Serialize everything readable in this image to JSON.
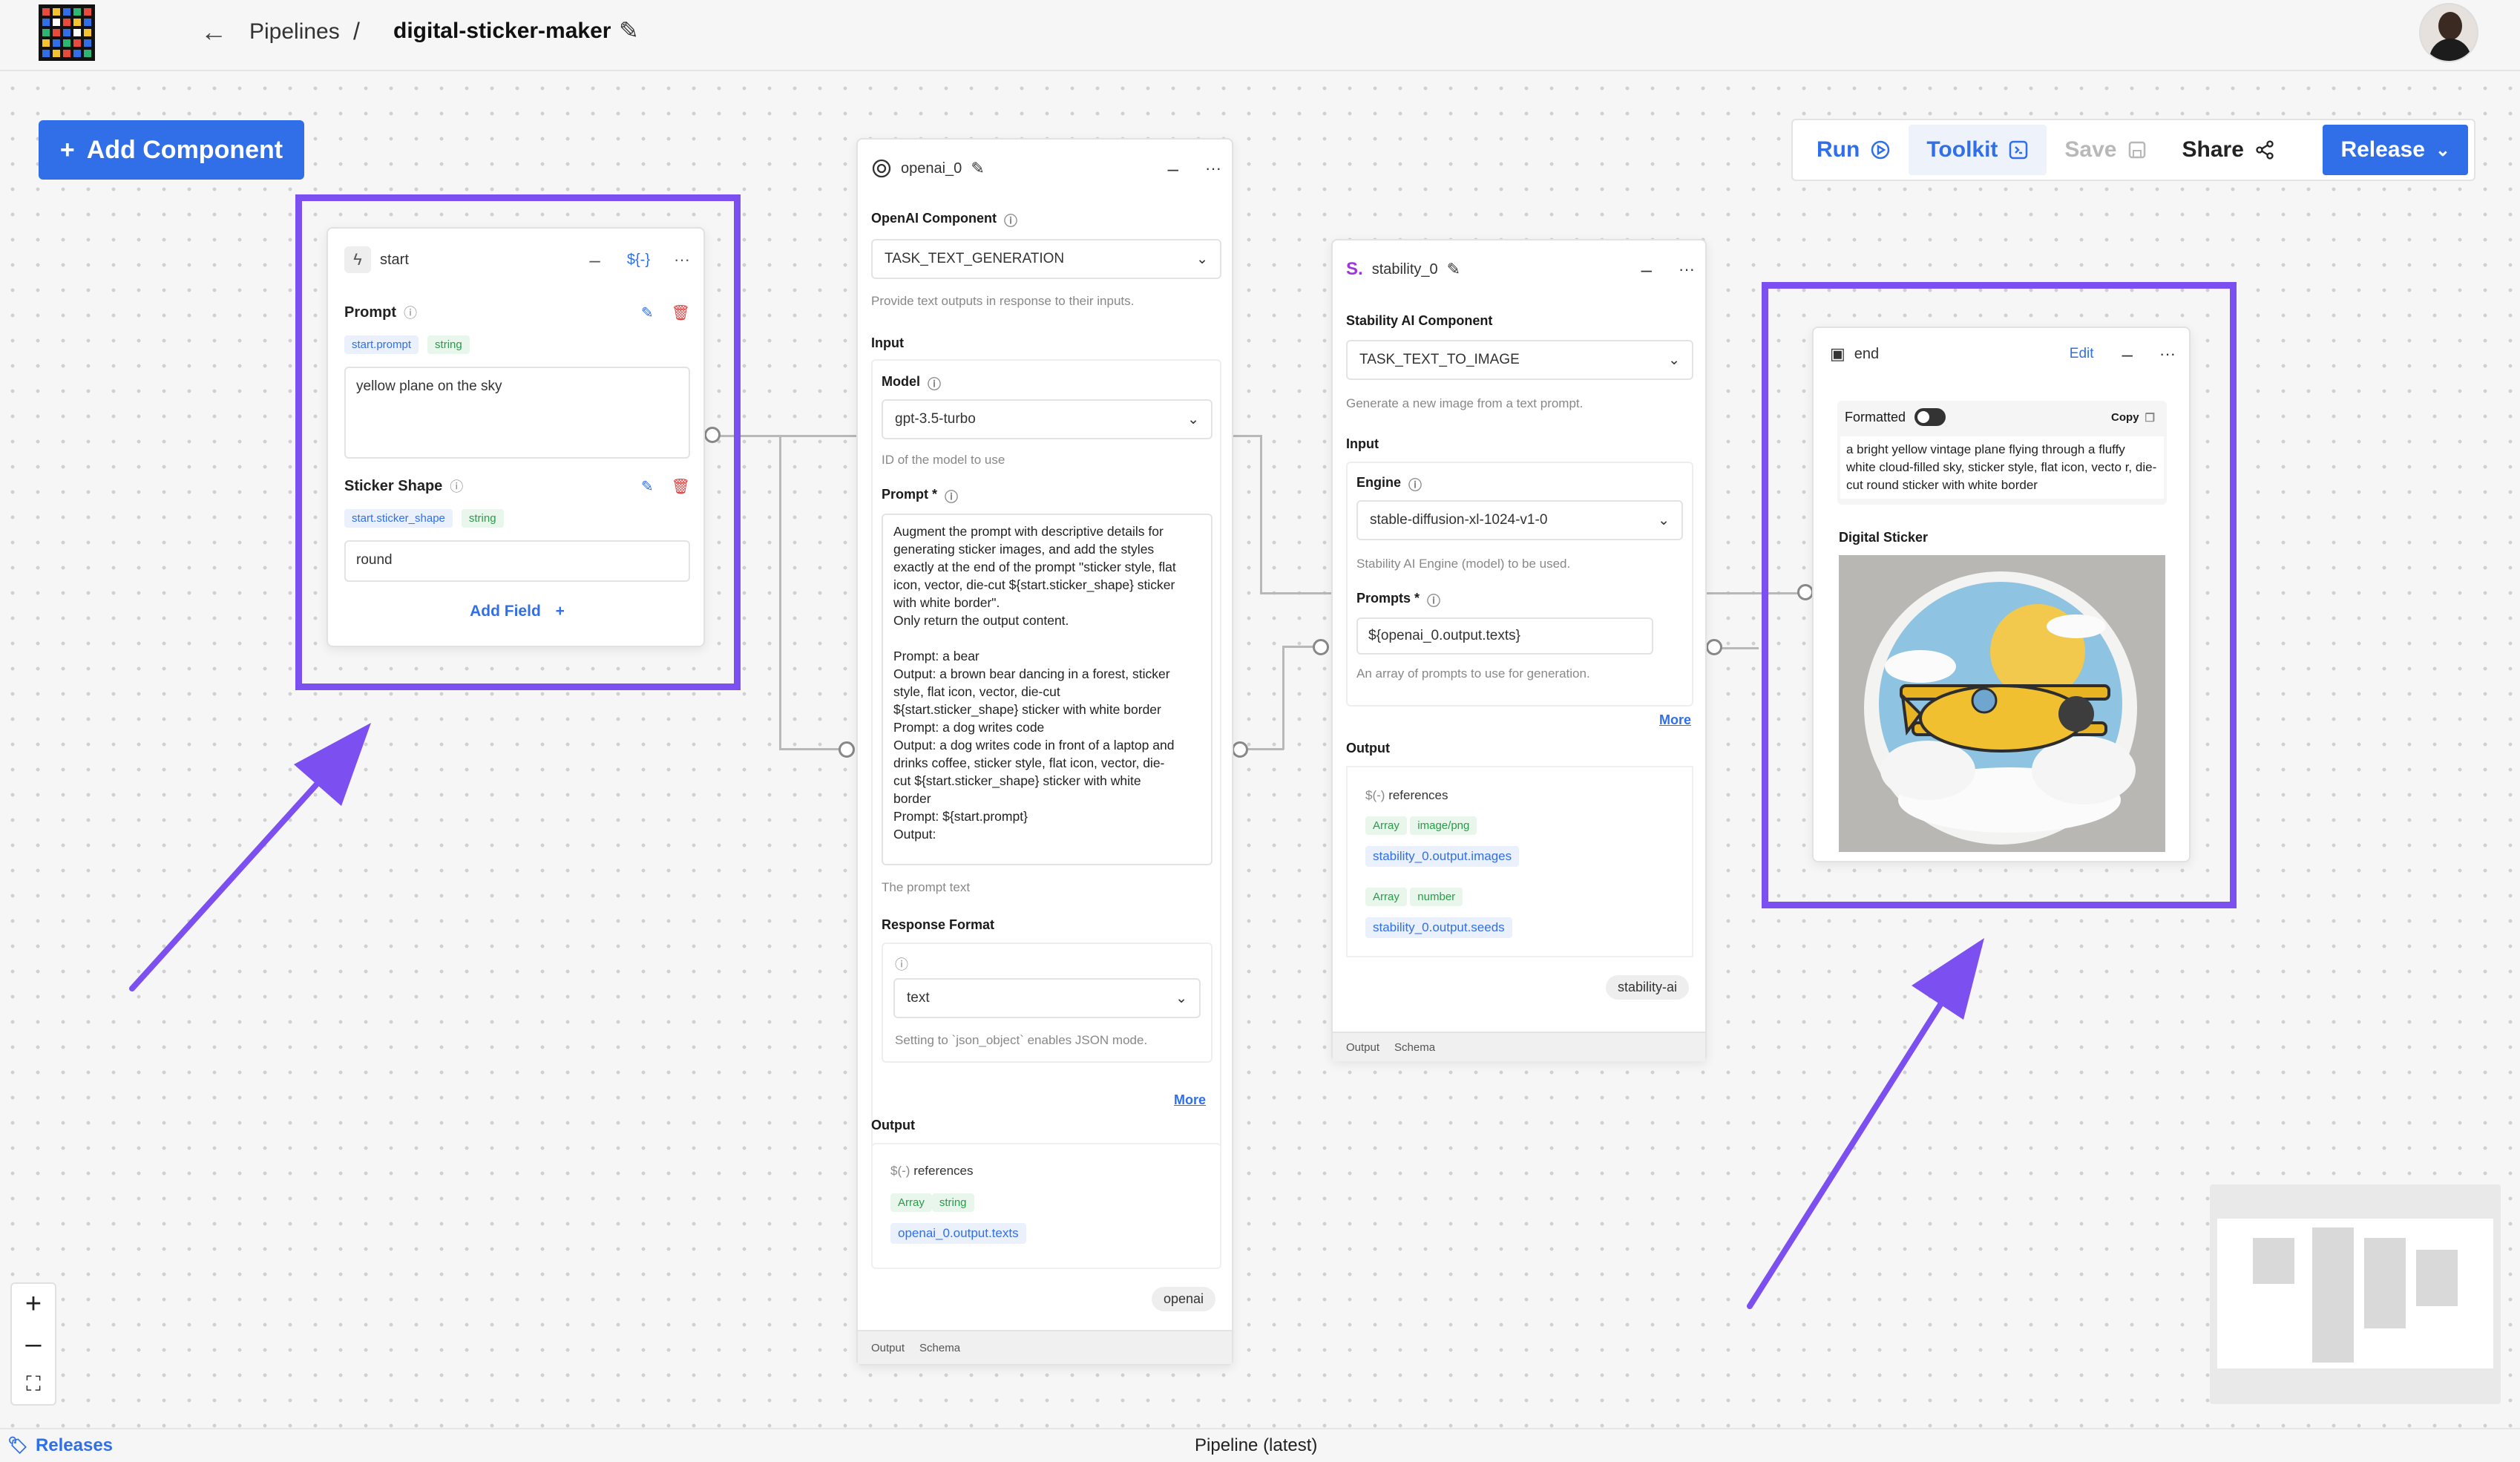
{
  "header": {
    "crumb_pipelines": "Pipelines",
    "crumb_sep": "/",
    "pipeline_name": "digital-sticker-maker"
  },
  "toolbar": {
    "add_component": "Add Component",
    "run": "Run",
    "toolkit": "Toolkit",
    "save": "Save",
    "share": "Share",
    "release": "Release"
  },
  "start_node": {
    "title": "start",
    "var_badge": "${-}",
    "fields": [
      {
        "label": "Prompt",
        "ref": "start.prompt",
        "type": "string",
        "value": "yellow plane on the sky"
      },
      {
        "label": "Sticker Shape",
        "ref": "start.sticker_shape",
        "type": "string",
        "value": "round"
      }
    ],
    "add_field": "Add Field"
  },
  "openai_node": {
    "title": "openai_0",
    "component_label": "OpenAI Component",
    "task": "TASK_TEXT_GENERATION",
    "task_desc": "Provide text outputs in response to their inputs.",
    "input_label": "Input",
    "model_label": "Model",
    "model_value": "gpt-3.5-turbo",
    "model_desc": "ID of the model to use",
    "prompt_label": "Prompt *",
    "prompt_value": "Augment the prompt with descriptive details for\ngenerating sticker images, and add the styles\nexactly at the end of the prompt \"sticker style, flat\nicon, vector, die-cut ${start.sticker_shape} sticker\nwith white border\".\nOnly return the output content.\n\nPrompt: a bear\nOutput: a brown bear dancing in a forest, sticker\nstyle, flat icon, vector, die-cut\n${start.sticker_shape} sticker with white border\nPrompt: a dog writes code\nOutput: a dog writes code in front of a laptop and\ndrinks coffee, sticker style, flat icon, vector, die-\ncut ${start.sticker_shape} sticker with white\nborder\nPrompt: ${start.prompt}\nOutput:",
    "prompt_desc": "The prompt text",
    "response_format_label": "Response Format",
    "response_format_value": "text",
    "response_format_desc": "Setting to `json_object` enables JSON mode.",
    "more": "More",
    "output_label": "Output",
    "references_label": "references",
    "ref_chip_array": "Array",
    "ref_chip_type": "string",
    "ref_path": "openai_0.output.texts",
    "provider": "openai",
    "tab_output": "Output",
    "tab_schema": "Schema"
  },
  "stability_node": {
    "title": "stability_0",
    "component_label": "Stability AI Component",
    "task": "TASK_TEXT_TO_IMAGE",
    "task_desc": "Generate a new image from a text prompt.",
    "input_label": "Input",
    "engine_label": "Engine",
    "engine_value": "stable-diffusion-xl-1024-v1-0",
    "engine_desc": "Stability AI Engine (model) to be used.",
    "prompts_label": "Prompts *",
    "prompts_value": "${openai_0.output.texts}",
    "prompts_desc": "An array of prompts to use for generation.",
    "more": "More",
    "output_label": "Output",
    "references_label": "references",
    "refs": [
      {
        "array": "Array",
        "type": "image/png",
        "path": "stability_0.output.images"
      },
      {
        "array": "Array",
        "type": "number",
        "path": "stability_0.output.seeds"
      }
    ],
    "provider": "stability-ai",
    "tab_output": "Output",
    "tab_schema": "Schema"
  },
  "end_node": {
    "title": "end",
    "edit": "Edit",
    "formatted": "Formatted",
    "copy": "Copy",
    "output_text": "a bright yellow vintage plane flying through a fluffy white cloud-filled sky, sticker style, flat icon, vecto r, die-cut round sticker with white border",
    "image_label": "Digital Sticker"
  },
  "footer": {
    "releases": "Releases",
    "pipeline_label": "Pipeline (latest)"
  },
  "colors": {
    "accent": "#316fe8",
    "highlight": "#7b4ff0"
  }
}
